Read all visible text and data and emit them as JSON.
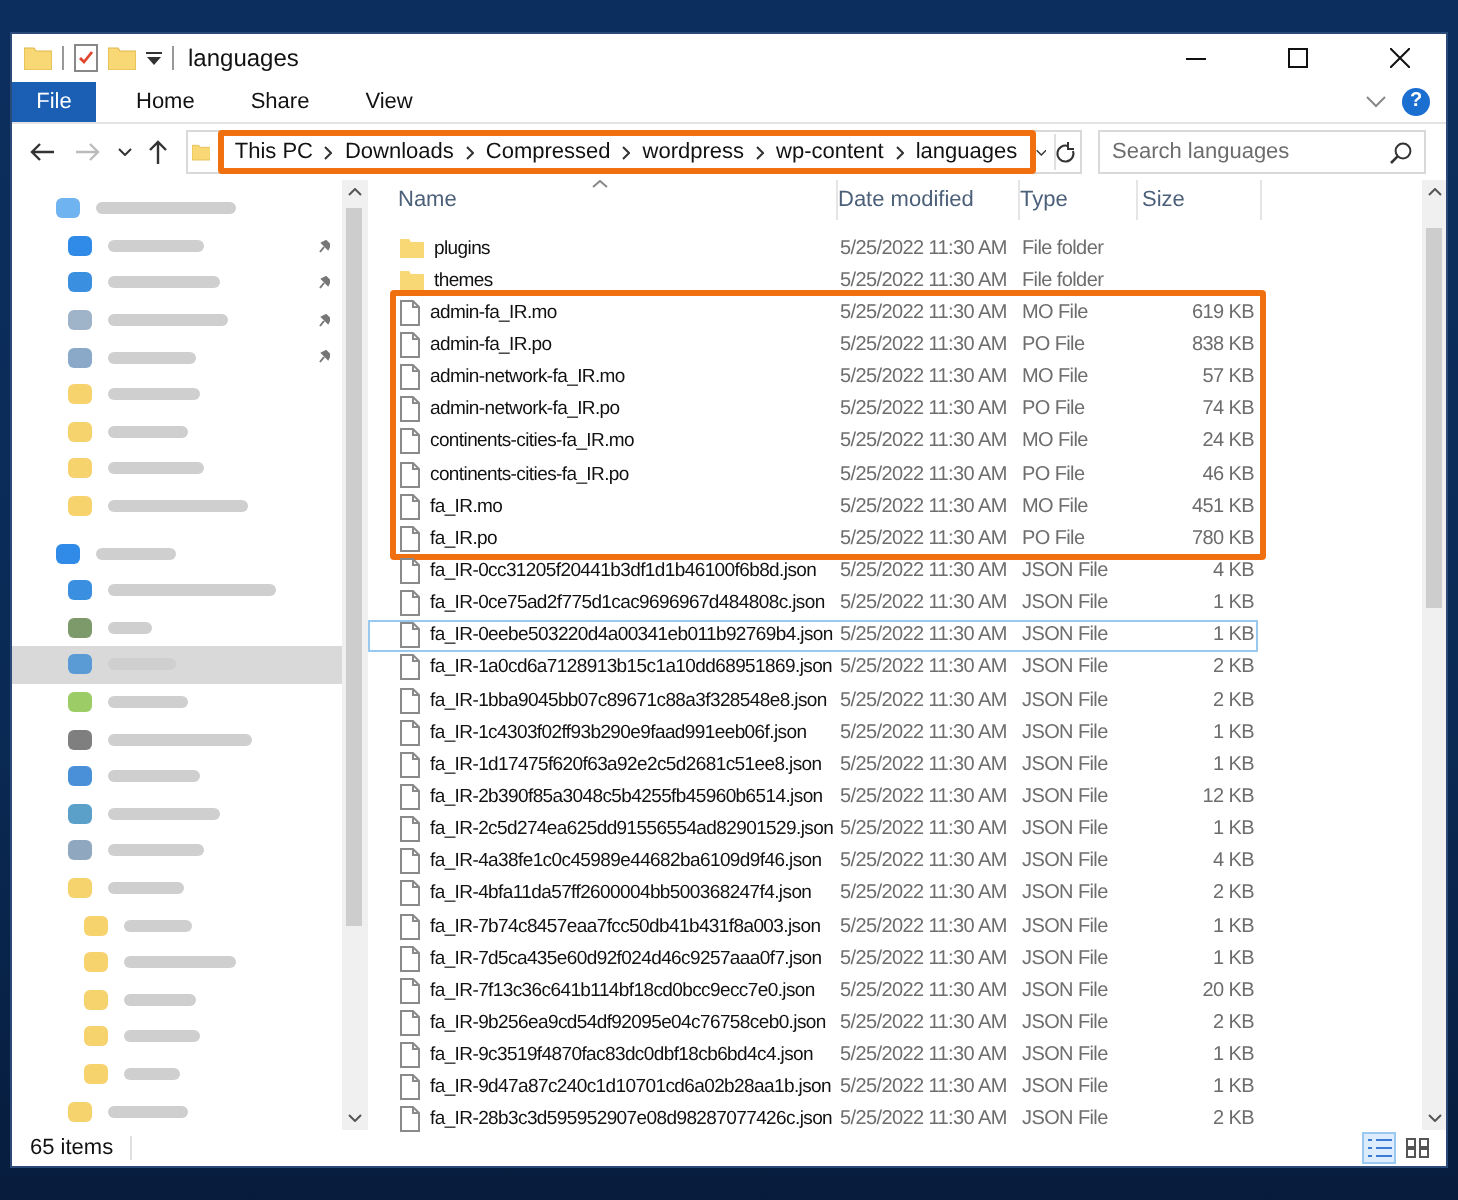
{
  "window": {
    "title": "languages"
  },
  "ribbon": {
    "file_tab": "File",
    "tabs": [
      {
        "label": "Home",
        "selected": false
      },
      {
        "label": "Share",
        "selected": false
      },
      {
        "label": "View",
        "selected": false
      }
    ],
    "help": "?"
  },
  "address_bar": {
    "highlighted": true,
    "crumbs": [
      "This PC",
      "Downloads",
      "Compressed",
      "wordpress",
      "wp-content",
      "languages"
    ]
  },
  "search": {
    "placeholder": "Search languages"
  },
  "sidebar": {
    "items": [
      {
        "kind": "header",
        "color": "#6fb3f0",
        "pinned": false,
        "selected": false
      },
      {
        "kind": "item",
        "color": "#2f8ae8",
        "pinned": true,
        "selected": false
      },
      {
        "kind": "item",
        "color": "#3b8fe0",
        "pinned": true,
        "selected": false
      },
      {
        "kind": "item",
        "color": "#9fb4c8",
        "pinned": true,
        "selected": false
      },
      {
        "kind": "item",
        "color": "#8aa9c9",
        "pinned": true,
        "selected": false
      },
      {
        "kind": "item",
        "color": "#f6d36c",
        "pinned": false,
        "selected": false
      },
      {
        "kind": "item",
        "color": "#f6d36c",
        "pinned": false,
        "selected": false
      },
      {
        "kind": "item",
        "color": "#f6d36c",
        "pinned": false,
        "selected": false
      },
      {
        "kind": "item",
        "color": "#f6d36c",
        "pinned": false,
        "selected": false
      },
      {
        "kind": "header",
        "color": "#2f8ae8",
        "pinned": false,
        "selected": false
      },
      {
        "kind": "item",
        "color": "#3b8fe0",
        "pinned": false,
        "selected": false
      },
      {
        "kind": "item",
        "color": "#7c9a6a",
        "pinned": false,
        "selected": false
      },
      {
        "kind": "item",
        "color": "#5b9bd5",
        "pinned": false,
        "selected": true
      },
      {
        "kind": "item",
        "color": "#9ccc65",
        "pinned": false,
        "selected": false
      },
      {
        "kind": "item",
        "color": "#7f7f7f",
        "pinned": false,
        "selected": false
      },
      {
        "kind": "item",
        "color": "#4a90d9",
        "pinned": false,
        "selected": false
      },
      {
        "kind": "item",
        "color": "#5aa0c8",
        "pinned": false,
        "selected": false
      },
      {
        "kind": "item",
        "color": "#8fa8c0",
        "pinned": false,
        "selected": false
      },
      {
        "kind": "item",
        "color": "#f6d36c",
        "pinned": false,
        "selected": false
      },
      {
        "kind": "subitem",
        "color": "#f6d36c",
        "pinned": false,
        "selected": false
      },
      {
        "kind": "subitem",
        "color": "#f6d36c",
        "pinned": false,
        "selected": false
      },
      {
        "kind": "subitem",
        "color": "#f6d36c",
        "pinned": false,
        "selected": false
      },
      {
        "kind": "subitem",
        "color": "#f6d36c",
        "pinned": false,
        "selected": false
      },
      {
        "kind": "subitem",
        "color": "#f6d36c",
        "pinned": false,
        "selected": false
      },
      {
        "kind": "item",
        "color": "#f6d36c",
        "pinned": false,
        "selected": false
      }
    ]
  },
  "columns": {
    "sorted_by_name": true,
    "labels": [
      "Name",
      "Date modified",
      "Type",
      "Size"
    ]
  },
  "rows": [
    {
      "kind": "folder",
      "name": "plugins",
      "date": "5/25/2022 11:30 AM",
      "type": "File folder",
      "highlighted": false,
      "focused": false,
      "selected": false
    },
    {
      "kind": "folder",
      "name": "themes",
      "date": "5/25/2022 11:30 AM",
      "type": "File folder",
      "highlighted": false,
      "focused": false,
      "selected": false
    },
    {
      "kind": "file",
      "name": "admin-fa_IR.mo",
      "date": "5/25/2022 11:30 AM",
      "type": "MO File",
      "size": "619 KB",
      "highlighted": true,
      "focused": false,
      "selected": false
    },
    {
      "kind": "file",
      "name": "admin-fa_IR.po",
      "date": "5/25/2022 11:30 AM",
      "type": "PO File",
      "size": "838 KB",
      "highlighted": true,
      "focused": false,
      "selected": false
    },
    {
      "kind": "file",
      "name": "admin-network-fa_IR.mo",
      "date": "5/25/2022 11:30 AM",
      "type": "MO File",
      "size": "57 KB",
      "highlighted": true,
      "focused": false,
      "selected": false
    },
    {
      "kind": "file",
      "name": "admin-network-fa_IR.po",
      "date": "5/25/2022 11:30 AM",
      "type": "PO File",
      "size": "74 KB",
      "highlighted": true,
      "focused": false,
      "selected": false
    },
    {
      "kind": "file",
      "name": "continents-cities-fa_IR.mo",
      "date": "5/25/2022 11:30 AM",
      "type": "MO File",
      "size": "24 KB",
      "highlighted": true,
      "focused": false,
      "selected": false
    },
    {
      "kind": "file",
      "name": "continents-cities-fa_IR.po",
      "date": "5/25/2022 11:30 AM",
      "type": "PO File",
      "size": "46 KB",
      "highlighted": true,
      "focused": false,
      "selected": false
    },
    {
      "kind": "file",
      "name": "fa_IR.mo",
      "date": "5/25/2022 11:30 AM",
      "type": "MO File",
      "size": "451 KB",
      "highlighted": true,
      "focused": false,
      "selected": false
    },
    {
      "kind": "file",
      "name": "fa_IR.po",
      "date": "5/25/2022 11:30 AM",
      "type": "PO File",
      "size": "780 KB",
      "highlighted": true,
      "focused": false,
      "selected": false
    },
    {
      "kind": "file",
      "name": "fa_IR-0cc31205f20441b3df1d1b46100f6b8d.json",
      "date": "5/25/2022 11:30 AM",
      "type": "JSON File",
      "size": "4 KB",
      "highlighted": false,
      "focused": false,
      "selected": false
    },
    {
      "kind": "file",
      "name": "fa_IR-0ce75ad2f775d1cac9696967d484808c.json",
      "date": "5/25/2022 11:30 AM",
      "type": "JSON File",
      "size": "1 KB",
      "highlighted": false,
      "focused": false,
      "selected": false
    },
    {
      "kind": "file",
      "name": "fa_IR-0eebe503220d4a00341eb011b92769b4.json",
      "date": "5/25/2022 11:30 AM",
      "type": "JSON File",
      "size": "1 KB",
      "highlighted": false,
      "focused": true,
      "selected": false
    },
    {
      "kind": "file",
      "name": "fa_IR-1a0cd6a7128913b15c1a10dd68951869.json",
      "date": "5/25/2022 11:30 AM",
      "type": "JSON File",
      "size": "2 KB",
      "highlighted": false,
      "focused": false,
      "selected": false
    },
    {
      "kind": "file",
      "name": "fa_IR-1bba9045bb07c89671c88a3f328548e8.json",
      "date": "5/25/2022 11:30 AM",
      "type": "JSON File",
      "size": "2 KB",
      "highlighted": false,
      "focused": false,
      "selected": false
    },
    {
      "kind": "file",
      "name": "fa_IR-1c4303f02ff93b290e9faad991eeb06f.json",
      "date": "5/25/2022 11:30 AM",
      "type": "JSON File",
      "size": "1 KB",
      "highlighted": false,
      "focused": false,
      "selected": false
    },
    {
      "kind": "file",
      "name": "fa_IR-1d17475f620f63a92e2c5d2681c51ee8.json",
      "date": "5/25/2022 11:30 AM",
      "type": "JSON File",
      "size": "1 KB",
      "highlighted": false,
      "focused": false,
      "selected": false
    },
    {
      "kind": "file",
      "name": "fa_IR-2b390f85a3048c5b4255fb45960b6514.json",
      "date": "5/25/2022 11:30 AM",
      "type": "JSON File",
      "size": "12 KB",
      "highlighted": false,
      "focused": false,
      "selected": false
    },
    {
      "kind": "file",
      "name": "fa_IR-2c5d274ea625dd91556554ad82901529.json",
      "date": "5/25/2022 11:30 AM",
      "type": "JSON File",
      "size": "1 KB",
      "highlighted": false,
      "focused": false,
      "selected": false
    },
    {
      "kind": "file",
      "name": "fa_IR-4a38fe1c0c45989e44682ba6109d9f46.json",
      "date": "5/25/2022 11:30 AM",
      "type": "JSON File",
      "size": "4 KB",
      "highlighted": false,
      "focused": false,
      "selected": false
    },
    {
      "kind": "file",
      "name": "fa_IR-4bfa11da57ff2600004bb500368247f4.json",
      "date": "5/25/2022 11:30 AM",
      "type": "JSON File",
      "size": "2 KB",
      "highlighted": false,
      "focused": false,
      "selected": false
    },
    {
      "kind": "file",
      "name": "fa_IR-7b74c8457eaa7fcc50db41b431f8a003.json",
      "date": "5/25/2022 11:30 AM",
      "type": "JSON File",
      "size": "1 KB",
      "highlighted": false,
      "focused": false,
      "selected": false
    },
    {
      "kind": "file",
      "name": "fa_IR-7d5ca435e60d92f024d46c9257aaa0f7.json",
      "date": "5/25/2022 11:30 AM",
      "type": "JSON File",
      "size": "1 KB",
      "highlighted": false,
      "focused": false,
      "selected": false
    },
    {
      "kind": "file",
      "name": "fa_IR-7f13c36c641b114bf18cd0bcc9ecc7e0.json",
      "date": "5/25/2022 11:30 AM",
      "type": "JSON File",
      "size": "20 KB",
      "highlighted": false,
      "focused": false,
      "selected": false
    },
    {
      "kind": "file",
      "name": "fa_IR-9b256ea9cd54df92095e04c76758ceb0.json",
      "date": "5/25/2022 11:30 AM",
      "type": "JSON File",
      "size": "2 KB",
      "highlighted": false,
      "focused": false,
      "selected": false
    },
    {
      "kind": "file",
      "name": "fa_IR-9c3519f4870fac83dc0dbf18cb6bd4c4.json",
      "date": "5/25/2022 11:30 AM",
      "type": "JSON File",
      "size": "1 KB",
      "highlighted": false,
      "focused": false,
      "selected": false
    },
    {
      "kind": "file",
      "name": "fa_IR-9d47a87c240c1d10701cd6a02b28aa1b.json",
      "date": "5/25/2022 11:30 AM",
      "type": "JSON File",
      "size": "1 KB",
      "highlighted": false,
      "focused": false,
      "selected": false
    },
    {
      "kind": "file",
      "name": "fa_IR-28b3c3d595952907e08d98287077426c.json",
      "date": "5/25/2022 11:30 AM",
      "type": "JSON File",
      "size": "2 KB",
      "highlighted": false,
      "focused": false,
      "selected": false
    }
  ],
  "status_bar": {
    "count": "65 items",
    "views": [
      {
        "kind": "details",
        "selected": true
      },
      {
        "kind": "large-icons",
        "selected": false
      }
    ]
  }
}
